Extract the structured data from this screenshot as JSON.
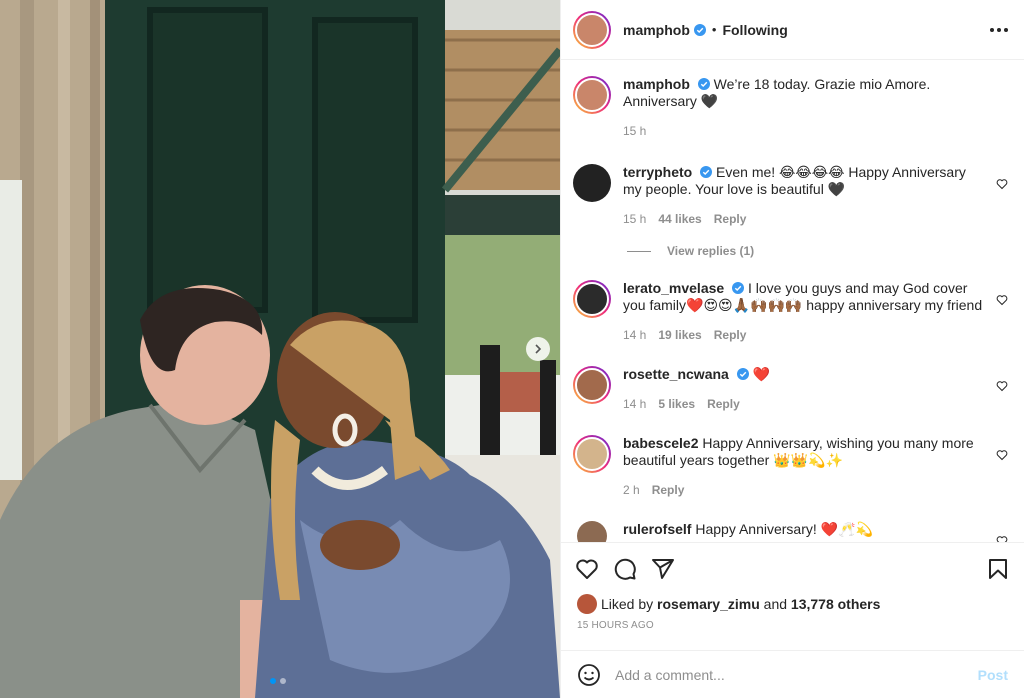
{
  "header": {
    "username": "mamphob",
    "separator": "•",
    "follow_label": "Following"
  },
  "caption": {
    "username": "mamphob",
    "text": "We’re 18 today. Grazie mio Amore. Anniversary 🖤",
    "time": "15 h"
  },
  "comments": [
    {
      "username": "terrypheto",
      "verified": true,
      "text": "Even me! 😂😂😂😂 Happy Anniversary my people. Your love is beautiful 🖤",
      "time": "15 h",
      "likes": "44 likes",
      "reply_label": "Reply"
    },
    {
      "username": "lerato_mvelase",
      "verified": true,
      "text": "I love you guys and may God cover you family❤️😍😍🙏🏾🙌🏾🙌🏾🙌🏾 happy anniversary my friend",
      "time": "14 h",
      "likes": "19 likes",
      "reply_label": "Reply"
    },
    {
      "username": "rosette_ncwana",
      "verified": true,
      "text": "❤️",
      "time": "14 h",
      "likes": "5 likes",
      "reply_label": "Reply"
    },
    {
      "username": "babescele2",
      "verified": false,
      "text": "Happy Anniversary, wishing you many more beautiful years together 👑👑💫✨",
      "time": "2 h",
      "likes": "",
      "reply_label": "Reply"
    },
    {
      "username": "rulerofself",
      "verified": false,
      "text": "Happy Anniversary! ❤️🥂💫",
      "time": "",
      "likes": "",
      "reply_label": ""
    }
  ],
  "view_replies_label": "View replies (1)",
  "likes": {
    "prefix": "Liked by",
    "user": "rosemary_zimu",
    "middle": "and",
    "count": "13,778 others"
  },
  "timestamp": "15 HOURS AGO",
  "add_comment": {
    "placeholder": "Add a comment...",
    "post_label": "Post"
  },
  "carousel": {
    "total": 2,
    "current": 1
  },
  "colors": {
    "verified": "#3897f0",
    "link_blue": "#0095f6",
    "post_disabled": "#b2dffc"
  },
  "icons": [
    "heart-icon",
    "comment-icon",
    "share-icon",
    "bookmark-icon",
    "emoji-icon",
    "more-icon",
    "chevron-right-icon",
    "verified-badge-icon"
  ]
}
